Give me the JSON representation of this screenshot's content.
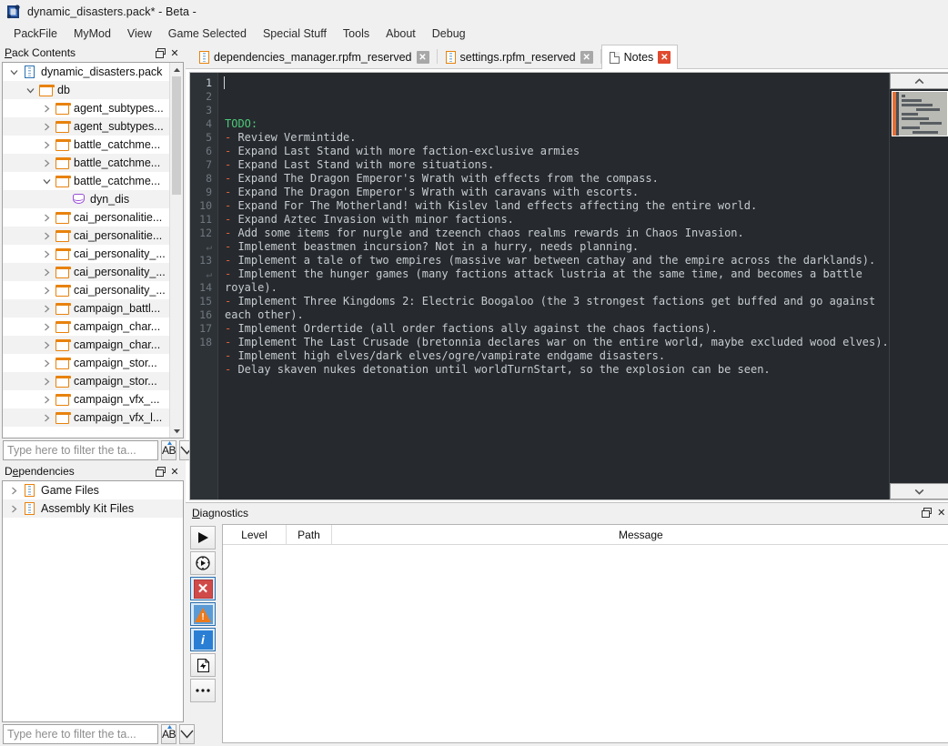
{
  "window": {
    "title": "dynamic_disasters.pack* - Beta -",
    "icon": "app-icon"
  },
  "menu": {
    "items": [
      {
        "label": "PackFile"
      },
      {
        "label": "MyMod"
      },
      {
        "label": "View"
      },
      {
        "label": "Game Selected"
      },
      {
        "label": "Special Stuff"
      },
      {
        "label": "Tools"
      },
      {
        "label": "About"
      },
      {
        "label": "Debug"
      }
    ]
  },
  "pack_contents": {
    "title": "Pack Contents",
    "title_accel": "P",
    "float_label": "❐",
    "close_label": "✕",
    "filter": {
      "placeholder": "Type here to filter the ta...",
      "value": "",
      "case_button": "AB",
      "expand_button": "▽"
    },
    "tree": [
      {
        "label": "dynamic_disasters.pack",
        "icon": "pack-icon-blue",
        "depth": 0,
        "twist": "down"
      },
      {
        "label": "db",
        "icon": "folder-icon",
        "depth": 1,
        "twist": "down"
      },
      {
        "label": "agent_subtypes...",
        "icon": "folder-icon",
        "depth": 2,
        "twist": "right"
      },
      {
        "label": "agent_subtypes...",
        "icon": "folder-icon",
        "depth": 2,
        "twist": "right"
      },
      {
        "label": "battle_catchme...",
        "icon": "folder-icon",
        "depth": 2,
        "twist": "right"
      },
      {
        "label": "battle_catchme...",
        "icon": "folder-icon",
        "depth": 2,
        "twist": "right"
      },
      {
        "label": "battle_catchme...",
        "icon": "folder-icon",
        "depth": 2,
        "twist": "down"
      },
      {
        "label": "dyn_dis",
        "icon": "db-table-icon",
        "depth": 3,
        "twist": "none"
      },
      {
        "label": "cai_personalitie...",
        "icon": "folder-icon",
        "depth": 2,
        "twist": "right"
      },
      {
        "label": "cai_personalitie...",
        "icon": "folder-icon",
        "depth": 2,
        "twist": "right"
      },
      {
        "label": "cai_personality_...",
        "icon": "folder-icon",
        "depth": 2,
        "twist": "right"
      },
      {
        "label": "cai_personality_...",
        "icon": "folder-icon",
        "depth": 2,
        "twist": "right"
      },
      {
        "label": "cai_personality_...",
        "icon": "folder-icon",
        "depth": 2,
        "twist": "right"
      },
      {
        "label": "campaign_battl...",
        "icon": "folder-icon",
        "depth": 2,
        "twist": "right"
      },
      {
        "label": "campaign_char...",
        "icon": "folder-icon",
        "depth": 2,
        "twist": "right"
      },
      {
        "label": "campaign_char...",
        "icon": "folder-icon",
        "depth": 2,
        "twist": "right"
      },
      {
        "label": "campaign_stor...",
        "icon": "folder-icon",
        "depth": 2,
        "twist": "right"
      },
      {
        "label": "campaign_stor...",
        "icon": "folder-icon",
        "depth": 2,
        "twist": "right"
      },
      {
        "label": "campaign_vfx_...",
        "icon": "folder-icon",
        "depth": 2,
        "twist": "right"
      },
      {
        "label": "campaign_vfx_l...",
        "icon": "folder-icon",
        "depth": 2,
        "twist": "right"
      }
    ]
  },
  "dependencies": {
    "title": "Dependencies",
    "title_accel": "D",
    "float_label": "❐",
    "close_label": "✕",
    "filter": {
      "placeholder": "Type here to filter the ta...",
      "value": "",
      "case_button": "AB",
      "expand_button": "▽"
    },
    "tree": [
      {
        "label": "Game Files",
        "icon": "pack-icon",
        "depth": 0,
        "twist": "right"
      },
      {
        "label": "Assembly Kit Files",
        "icon": "pack-icon",
        "depth": 0,
        "twist": "right"
      }
    ]
  },
  "tabs": [
    {
      "label": "dependencies_manager.rpfm_reserved",
      "icon": "pack-icon",
      "active": false,
      "close": "✕"
    },
    {
      "label": "settings.rpfm_reserved",
      "icon": "pack-icon",
      "active": false,
      "close": "✕"
    },
    {
      "label": "Notes",
      "icon": "doc-icon",
      "active": true,
      "close": "✕"
    }
  ],
  "editor": {
    "scroll_up": "⌃",
    "scroll_down": "⌄",
    "lines": [
      {
        "num": "1",
        "prefix": "",
        "text": "TODO:",
        "style": "todo"
      },
      {
        "num": "2",
        "prefix": "- ",
        "text": "Review Vermintide.",
        "style": "dash"
      },
      {
        "num": "3",
        "prefix": "- ",
        "text": "Expand Last Stand with more faction-exclusive armies",
        "style": "dash"
      },
      {
        "num": "4",
        "prefix": "- ",
        "text": "Expand Last Stand with more situations.",
        "style": "dash"
      },
      {
        "num": "5",
        "prefix": "- ",
        "text": "Expand The Dragon Emperor's Wrath with effects from the compass.",
        "style": "dash"
      },
      {
        "num": "6",
        "prefix": "- ",
        "text": "Expand The Dragon Emperor's Wrath with caravans with escorts.",
        "style": "dash"
      },
      {
        "num": "7",
        "prefix": "- ",
        "text": "Expand For The Motherland! with Kislev land effects affecting the entire world.",
        "style": "dash"
      },
      {
        "num": "8",
        "prefix": "- ",
        "text": "Expand Aztec Invasion with minor factions.",
        "style": "dash"
      },
      {
        "num": "9",
        "prefix": "- ",
        "text": "Add some items for nurgle and tzeench chaos realms rewards in Chaos Invasion.",
        "style": "dash"
      },
      {
        "num": "10",
        "prefix": "- ",
        "text": "Implement beastmen incursion? Not in a hurry, needs planning.",
        "style": "dash"
      },
      {
        "num": "11",
        "prefix": "- ",
        "text": "Implement a tale of two empires (massive war between cathay and the empire across the darklands).",
        "style": "dash"
      },
      {
        "num": "12",
        "prefix": "- ",
        "text": "Implement the hunger games (many factions attack lustria at the same time, and becomes a battle",
        "style": "dash"
      },
      {
        "num": "↵",
        "prefix": "",
        "text": "royale).",
        "style": "plain",
        "wrap": true
      },
      {
        "num": "13",
        "prefix": "- ",
        "text": "Implement Three Kingdoms 2: Electric Boogaloo (the 3 strongest factions get buffed and go against",
        "style": "dash"
      },
      {
        "num": "↵",
        "prefix": "",
        "text": "each other).",
        "style": "plain",
        "wrap": true
      },
      {
        "num": "14",
        "prefix": "- ",
        "text": "Implement Ordertide (all order factions ally against the chaos factions).",
        "style": "dash"
      },
      {
        "num": "15",
        "prefix": "- ",
        "text": "Implement The Last Crusade (bretonnia declares war on the entire world, maybe excluded wood elves).",
        "style": "dash"
      },
      {
        "num": "16",
        "prefix": "- ",
        "text": "Implement high elves/dark elves/ogre/vampirate endgame disasters.",
        "style": "dash"
      },
      {
        "num": "17",
        "prefix": "- ",
        "text": "Delay skaven nukes detonation until worldTurnStart, so the explosion can be seen.",
        "style": "dash"
      },
      {
        "num": "18",
        "prefix": "",
        "text": "",
        "style": "plain"
      }
    ]
  },
  "diagnostics": {
    "title": "Diagnostics",
    "title_accel": "D",
    "float_label": "❐",
    "close_label": "✕",
    "toolbar": [
      {
        "name": "run-diagnostics-button",
        "glyph": "▶",
        "kind": "play"
      },
      {
        "name": "run-settings-button",
        "glyph": "⚙",
        "kind": "gear-play"
      },
      {
        "name": "filter-errors-button",
        "glyph": "✕",
        "kind": "error",
        "active": true
      },
      {
        "name": "filter-warnings-button",
        "glyph": "!",
        "kind": "warning",
        "active": true
      },
      {
        "name": "filter-info-button",
        "glyph": "i",
        "kind": "info",
        "active": true
      },
      {
        "name": "show-outdated-button",
        "glyph": "↺",
        "kind": "refresh"
      },
      {
        "name": "more-options-button",
        "glyph": "⋯",
        "kind": "more"
      }
    ],
    "columns": [
      {
        "label": "Level"
      },
      {
        "label": "Path"
      },
      {
        "label": "Message"
      }
    ],
    "rows": []
  },
  "colors": {
    "accent_orange": "#e8820c",
    "editor_bg": "#262a2e",
    "gutter_bg": "#2d3237",
    "todo_green": "#4ec97a",
    "dash_red": "#e0603a",
    "code_text": "#c6ccd2",
    "tab_close_active": "#e04a2f"
  }
}
